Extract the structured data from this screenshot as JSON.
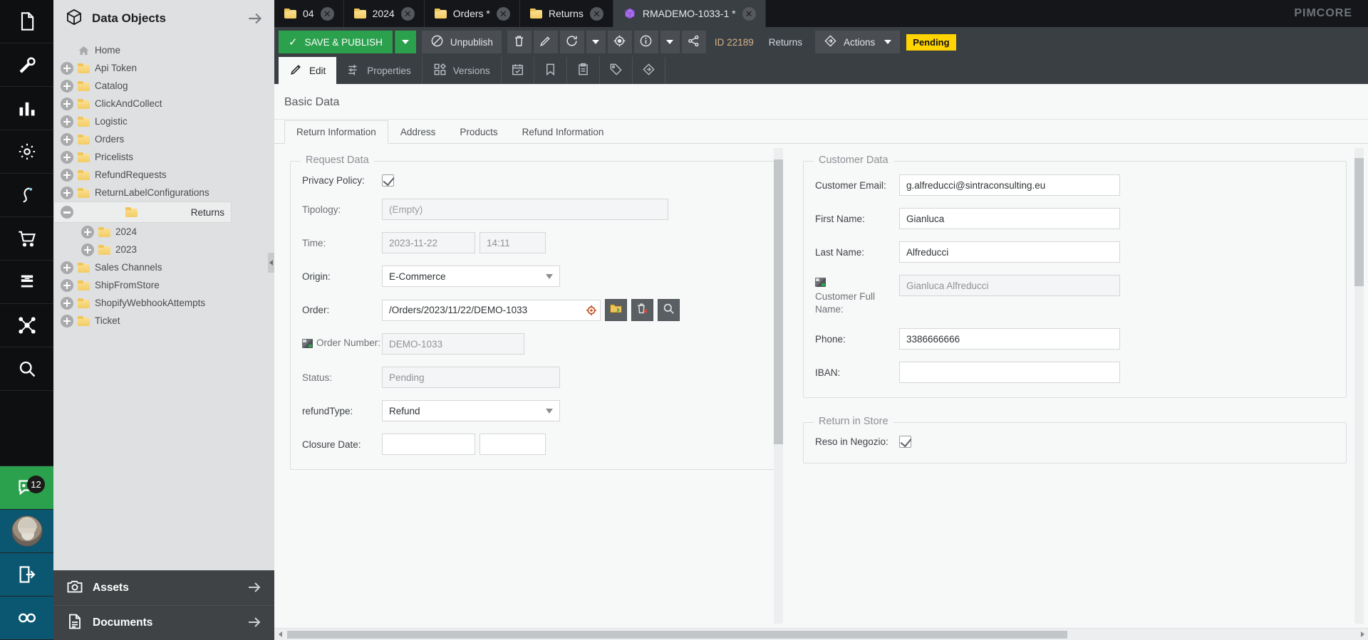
{
  "rail": {
    "items": [
      {
        "name": "documents-icon",
        "icon": "file"
      },
      {
        "name": "tools-icon",
        "icon": "wrench"
      },
      {
        "name": "reports-icon",
        "icon": "bars"
      },
      {
        "name": "settings-icon",
        "icon": "gear"
      },
      {
        "name": "marketing-icon",
        "icon": "pen"
      },
      {
        "name": "ecommerce-icon",
        "icon": "cart"
      },
      {
        "name": "sitemap-icon",
        "icon": "s-mark"
      },
      {
        "name": "workflow-icon",
        "icon": "nodes"
      },
      {
        "name": "search-icon",
        "icon": "magnifier"
      }
    ],
    "notifications_count": "12",
    "logout_icon": "logout",
    "infinity_icon": "infinity"
  },
  "tree": {
    "title": "Data Objects",
    "title_icon": "cube-icon",
    "expand_icon": "arrow-right-icon",
    "nodes": [
      {
        "label": "Home",
        "icon": "home",
        "indent": 0,
        "expander": "none",
        "selected": false
      },
      {
        "label": "Api Token",
        "icon": "folder",
        "indent": 0,
        "expander": "plus",
        "selected": false
      },
      {
        "label": "Catalog",
        "icon": "folder",
        "indent": 0,
        "expander": "plus",
        "selected": false
      },
      {
        "label": "ClickAndCollect",
        "icon": "folder",
        "indent": 0,
        "expander": "plus",
        "selected": false
      },
      {
        "label": "Logistic",
        "icon": "folder",
        "indent": 0,
        "expander": "plus",
        "selected": false
      },
      {
        "label": "Orders",
        "icon": "folder",
        "indent": 0,
        "expander": "plus",
        "selected": false
      },
      {
        "label": "Pricelists",
        "icon": "folder",
        "indent": 0,
        "expander": "plus",
        "selected": false
      },
      {
        "label": "RefundRequests",
        "icon": "folder",
        "indent": 0,
        "expander": "plus",
        "selected": false
      },
      {
        "label": "ReturnLabelConfigurations",
        "icon": "folder",
        "indent": 0,
        "expander": "plus",
        "selected": false
      },
      {
        "label": "Returns",
        "icon": "folder",
        "indent": 0,
        "expander": "minus",
        "selected": true
      },
      {
        "label": "2024",
        "icon": "folder",
        "indent": 1,
        "expander": "plus",
        "selected": false
      },
      {
        "label": "2023",
        "icon": "folder",
        "indent": 1,
        "expander": "plus",
        "selected": false
      },
      {
        "label": "Sales Channels",
        "icon": "folder",
        "indent": 0,
        "expander": "plus",
        "selected": false
      },
      {
        "label": "ShipFromStore",
        "icon": "folder",
        "indent": 0,
        "expander": "plus",
        "selected": false
      },
      {
        "label": "ShopifyWebhookAttempts",
        "icon": "folder",
        "indent": 0,
        "expander": "plus",
        "selected": false
      },
      {
        "label": "Ticket",
        "icon": "folder",
        "indent": 0,
        "expander": "plus",
        "selected": false
      }
    ],
    "panels": [
      {
        "label": "Assets",
        "icon": "camera-icon"
      },
      {
        "label": "Documents",
        "icon": "document-icon"
      }
    ]
  },
  "doc_tabs": {
    "brand": "PIMCORE",
    "items": [
      {
        "label": "04",
        "icon": "folder",
        "active": false
      },
      {
        "label": "2024",
        "icon": "folder",
        "active": false
      },
      {
        "label": "Orders *",
        "icon": "folder",
        "active": false
      },
      {
        "label": "Returns",
        "icon": "folder",
        "active": false
      },
      {
        "label": "RMADEMO-1033-1 *",
        "icon": "cube",
        "active": true
      }
    ],
    "close_glyph": "✕"
  },
  "toolbar": {
    "save_label": "SAVE & PUBLISH",
    "save_check": "✓",
    "save_menu_icon": "chevron-down-icon",
    "unpublish_label": "Unpublish",
    "unpublish_icon": "no-entry-icon",
    "delete_icon": "trash-icon",
    "rename_icon": "pencil-icon",
    "reload_icon": "reload-icon",
    "reload_menu_icon": "chevron-down-icon",
    "locate_icon": "target-icon",
    "info_icon": "info-icon",
    "info_menu_icon": "chevron-down-icon",
    "share_icon": "share-icon",
    "id_label": "ID 22189",
    "type_label": "Returns",
    "actions_label": "Actions",
    "actions_icon": "workflow-diamond-icon",
    "actions_menu_icon": "chevron-down-icon",
    "status_badge": "Pending",
    "accent_green": "#2ba14e",
    "badge_color": "#ffd400"
  },
  "subtabs": [
    {
      "label": "Edit",
      "icon": "pencil-icon",
      "active": true
    },
    {
      "label": "Properties",
      "icon": "sliders-icon",
      "active": false
    },
    {
      "label": "Versions",
      "icon": "blocks-icon",
      "active": false
    },
    {
      "label": "",
      "icon": "schedule-calendar-icon",
      "active": false
    },
    {
      "label": "",
      "icon": "bookmark-icon",
      "active": false
    },
    {
      "label": "",
      "icon": "clipboard-icon",
      "active": false
    },
    {
      "label": "",
      "icon": "tag-icon",
      "active": false
    },
    {
      "label": "",
      "icon": "diamond-icon",
      "active": false
    }
  ],
  "content": {
    "section_title": "Basic Data",
    "inner_tabs": [
      {
        "label": "Return Information",
        "active": true
      },
      {
        "label": "Address",
        "active": false
      },
      {
        "label": "Products",
        "active": false
      },
      {
        "label": "Refund Information",
        "active": false
      }
    ],
    "request_data": {
      "legend": "Request Data",
      "fields": {
        "privacy_policy_label": "Privacy Policy:",
        "privacy_policy_checked": true,
        "tipology_label": "Tipology:",
        "tipology_value": "(Empty)",
        "time_label": "Time:",
        "time_date": "2023-11-22",
        "time_clock": "14:11",
        "origin_label": "Origin:",
        "origin_value": "E-Commerce",
        "order_label": "Order:",
        "order_value": "/Orders/2023/11/22/DEMO-1033",
        "order_open_icon": "folder-open-icon",
        "order_delete_icon": "delete-relation-icon",
        "order_search_icon": "search-relation-icon",
        "order_number_label": "Order Number:",
        "order_number_value": "DEMO-1033",
        "status_label": "Status:",
        "status_value": "Pending",
        "refund_type_label": "refundType:",
        "refund_type_value": "Refund",
        "closure_date_label": "Closure Date:",
        "closure_date_value": "",
        "closure_time_value": ""
      }
    },
    "customer_data": {
      "legend": "Customer Data",
      "fields": {
        "email_label": "Customer Email:",
        "email_value": "g.alfreducci@sintraconsulting.eu",
        "first_name_label": "First Name:",
        "first_name_value": "Gianluca",
        "last_name_label": "Last Name:",
        "last_name_value": "Alfreducci",
        "full_name_label": "Customer Full Name:",
        "full_name_value": "Gianluca Alfreducci",
        "phone_label": "Phone:",
        "phone_value": "3386666666",
        "iban_label": "IBAN:",
        "iban_value": ""
      }
    },
    "return_in_store": {
      "legend": "Return in Store",
      "fields": {
        "reso_label": "Reso in Negozio:",
        "reso_checked": true
      }
    }
  }
}
